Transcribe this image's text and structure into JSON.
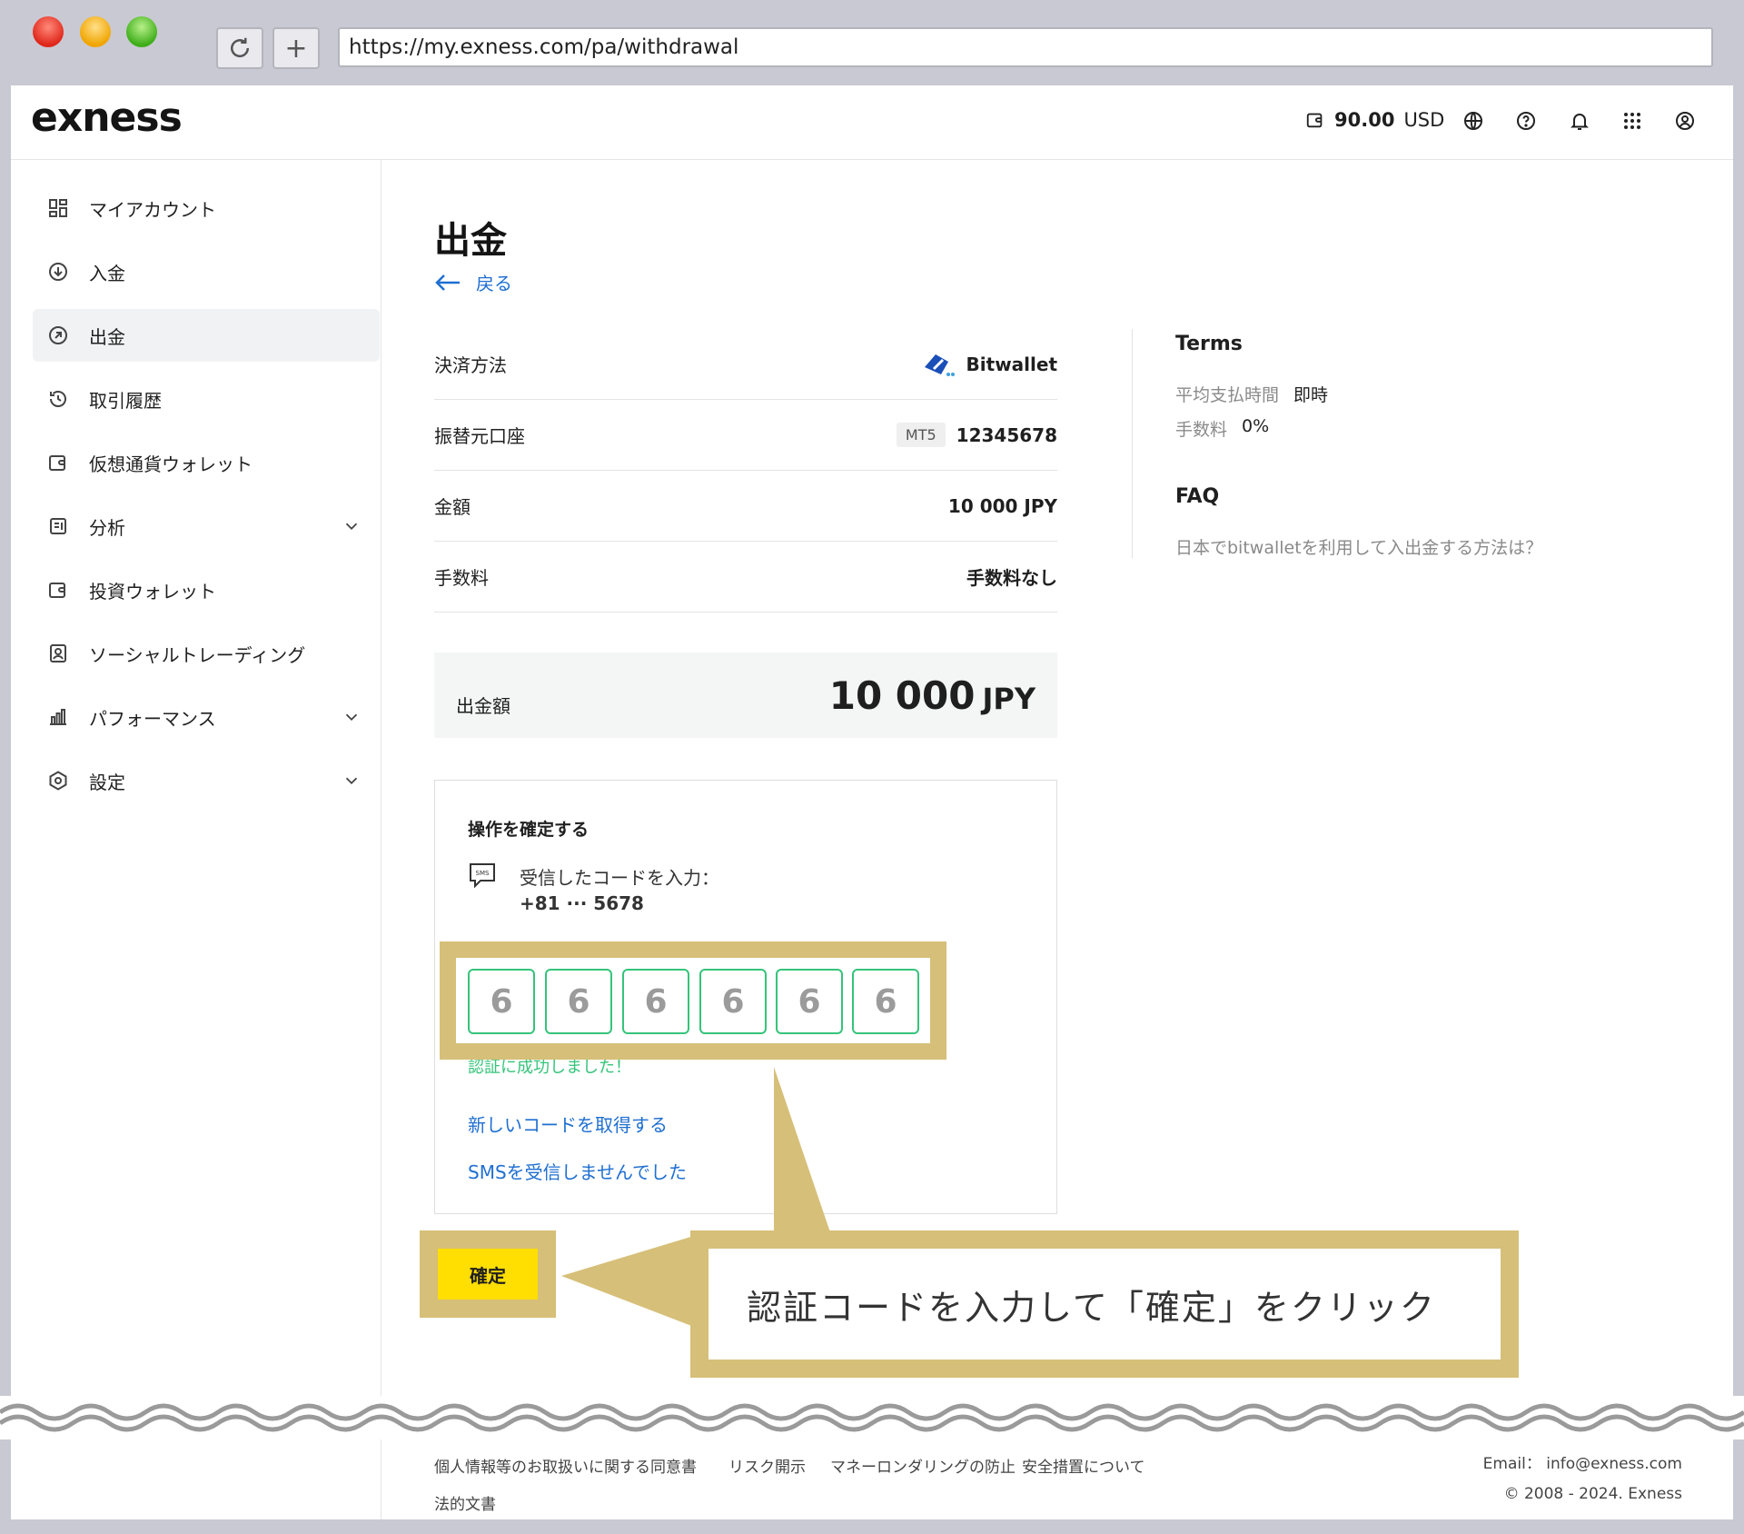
{
  "browser": {
    "url": "https://my.exness.com/pa/withdrawal",
    "reload_icon": "reload-icon",
    "new_tab_icon": "plus-icon"
  },
  "header": {
    "logo": "exness",
    "balance_amount": "90.00",
    "balance_currency": "USD"
  },
  "sidebar": {
    "items": [
      {
        "label": "マイアカウント",
        "icon": "dashboard-icon"
      },
      {
        "label": "入金",
        "icon": "deposit-icon"
      },
      {
        "label": "出金",
        "icon": "withdraw-icon"
      },
      {
        "label": "取引履歴",
        "icon": "history-icon"
      },
      {
        "label": "仮想通貨ウォレット",
        "icon": "wallet-icon"
      },
      {
        "label": "分析",
        "icon": "analytics-icon"
      },
      {
        "label": "投資ウォレット",
        "icon": "wallet-icon"
      },
      {
        "label": "ソーシャルトレーディング",
        "icon": "social-trading-icon"
      },
      {
        "label": "パフォーマンス",
        "icon": "bar-chart-icon"
      },
      {
        "label": "設定",
        "icon": "settings-icon"
      }
    ]
  },
  "main": {
    "title": "出金",
    "back_label": "戻る",
    "rows": [
      {
        "label": "決済方法",
        "value": "Bitwallet"
      },
      {
        "label": "振替元口座",
        "badge": "MT5",
        "value": "12345678"
      },
      {
        "label": "金額",
        "value": "10 000 JPY"
      },
      {
        "label": "手数料",
        "value": "手数料なし"
      }
    ],
    "total": {
      "label": "出金額",
      "amount": "10 000",
      "currency": "JPY"
    },
    "confirm": {
      "title": "操作を確定する",
      "prompt": "受信したコードを入力：",
      "phone": "+81 ··· 5678",
      "code_digits": [
        "6",
        "6",
        "6",
        "6",
        "6",
        "6"
      ],
      "success": "認証に成功しました！",
      "new_code_link": "新しいコードを取得する",
      "no_sms_link": "SMSを受信しませんでした"
    },
    "confirm_button": "確定",
    "callout": "認証コードを入力して「確定」をクリック"
  },
  "terms": {
    "title": "Terms",
    "avg_time_label": "平均支払時間",
    "avg_time_value": "即時",
    "fee_label": "手数料",
    "fee_value": "0%",
    "faq_title": "FAQ",
    "faq_link": "日本でbitwalletを利用して入出金する方法は？"
  },
  "footer": {
    "links": [
      "個人情報等のお取扱いに関する同意書",
      "リスク開示",
      "マネーロンダリングの防止",
      "安全措置について",
      "法的文書"
    ],
    "email": "Email： info@exness.com",
    "copyright": "© 2008 - 2024. Exness"
  },
  "colors": {
    "accent": "#ffde02",
    "link": "#1f6fd1",
    "success": "#35c47a",
    "highlight": "#d6bf78"
  }
}
